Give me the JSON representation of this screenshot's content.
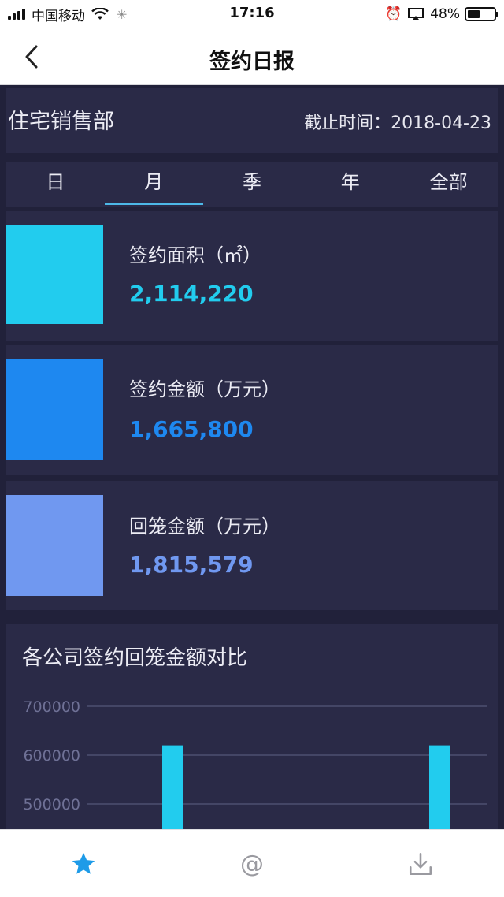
{
  "status_bar": {
    "carrier": "中国移动",
    "time": "17:16",
    "battery_percent": "48%",
    "battery_level": 0.48
  },
  "nav": {
    "title": "签约日报",
    "back_icon": "chevron-left-icon"
  },
  "header": {
    "department": "住宅销售部",
    "cutoff_label": "截止时间：",
    "cutoff_date": "2018-04-23"
  },
  "tabs": [
    {
      "label": "日",
      "active": false
    },
    {
      "label": "月",
      "active": true
    },
    {
      "label": "季",
      "active": false
    },
    {
      "label": "年",
      "active": false
    },
    {
      "label": "全部",
      "active": false
    }
  ],
  "stats": [
    {
      "label": "签约面积（㎡）",
      "value": "2,114,220",
      "color": "#22ccee"
    },
    {
      "label": "签约金额（万元）",
      "value": "1,665,800",
      "color": "#1e88f0"
    },
    {
      "label": "回笼金额（万元）",
      "value": "1,815,579",
      "color": "#7098f0"
    }
  ],
  "chart_data": {
    "type": "bar",
    "title": "各公司签约回笼金额对比",
    "yticks": [
      700000,
      600000,
      500000
    ],
    "ytick_labels": [
      "700000",
      "600000",
      "500000"
    ],
    "ylim": [
      500000,
      700000
    ],
    "series": [
      {
        "values": [
          620000,
          620000
        ],
        "color": "#22ccee"
      }
    ],
    "grid": true
  },
  "tabbar": {
    "items": [
      "star-icon",
      "at-icon",
      "download-icon"
    ],
    "active_color": "#1e9be8",
    "inactive_color": "#9a9aa0"
  }
}
